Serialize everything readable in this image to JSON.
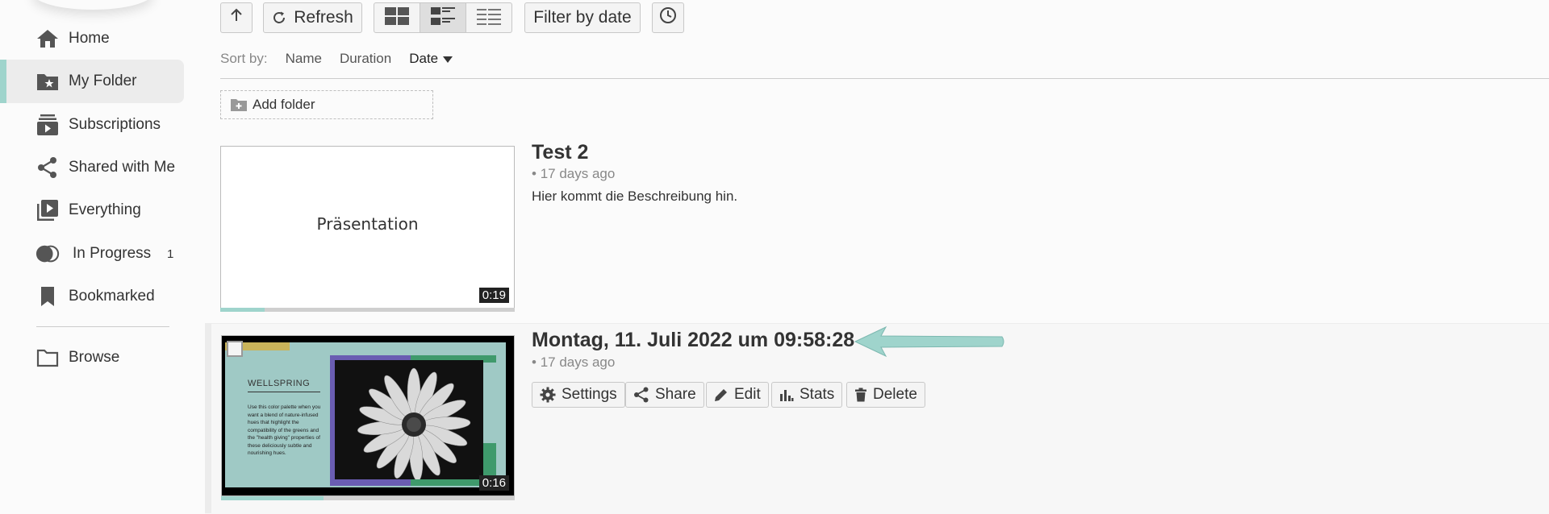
{
  "sidebar": {
    "items": [
      {
        "label": "Home",
        "icon": "home-icon"
      },
      {
        "label": "My Folder",
        "icon": "folder-star-icon",
        "active": true
      },
      {
        "label": "Subscriptions",
        "icon": "subscriptions-icon"
      },
      {
        "label": "Shared with Me",
        "icon": "share-icon"
      },
      {
        "label": "Everything",
        "icon": "video-library-icon"
      },
      {
        "label": "In Progress",
        "icon": "in-progress-icon",
        "count": "1"
      },
      {
        "label": "Bookmarked",
        "icon": "bookmark-icon"
      }
    ],
    "browse": {
      "label": "Browse",
      "icon": "folder-icon"
    }
  },
  "toolbar": {
    "refresh_label": "Refresh",
    "filter_label": "Filter by date",
    "view_modes": [
      "grid",
      "detailed-list",
      "compact-list"
    ],
    "active_view": "detailed-list"
  },
  "sort": {
    "label": "Sort by:",
    "options": [
      "Name",
      "Duration",
      "Date"
    ],
    "active": "Date"
  },
  "add_folder_label": "Add folder",
  "sessions": [
    {
      "title": "Test 2",
      "age": "17 days ago",
      "description": "Hier kommt die Beschreibung hin.",
      "thumb_text": "Präsentation",
      "duration": "0:19",
      "progress": 0.15
    },
    {
      "title": "Montag, 11. Juli 2022 um 09:58:28",
      "age": "17 days ago",
      "duration": "0:16",
      "progress": 0.35,
      "thumb_heading": "WELLSPRING",
      "thumb_body": "Use this color palette when you want a blend of nature-infused hues that highlight the compatibility of the greens and the \"health giving\" properties of these deliciously subtle and nourishing hues.",
      "actions": [
        "Settings",
        "Share",
        "Edit",
        "Stats",
        "Delete"
      ]
    }
  ],
  "colors": {
    "accent": "#9fd4cc"
  }
}
